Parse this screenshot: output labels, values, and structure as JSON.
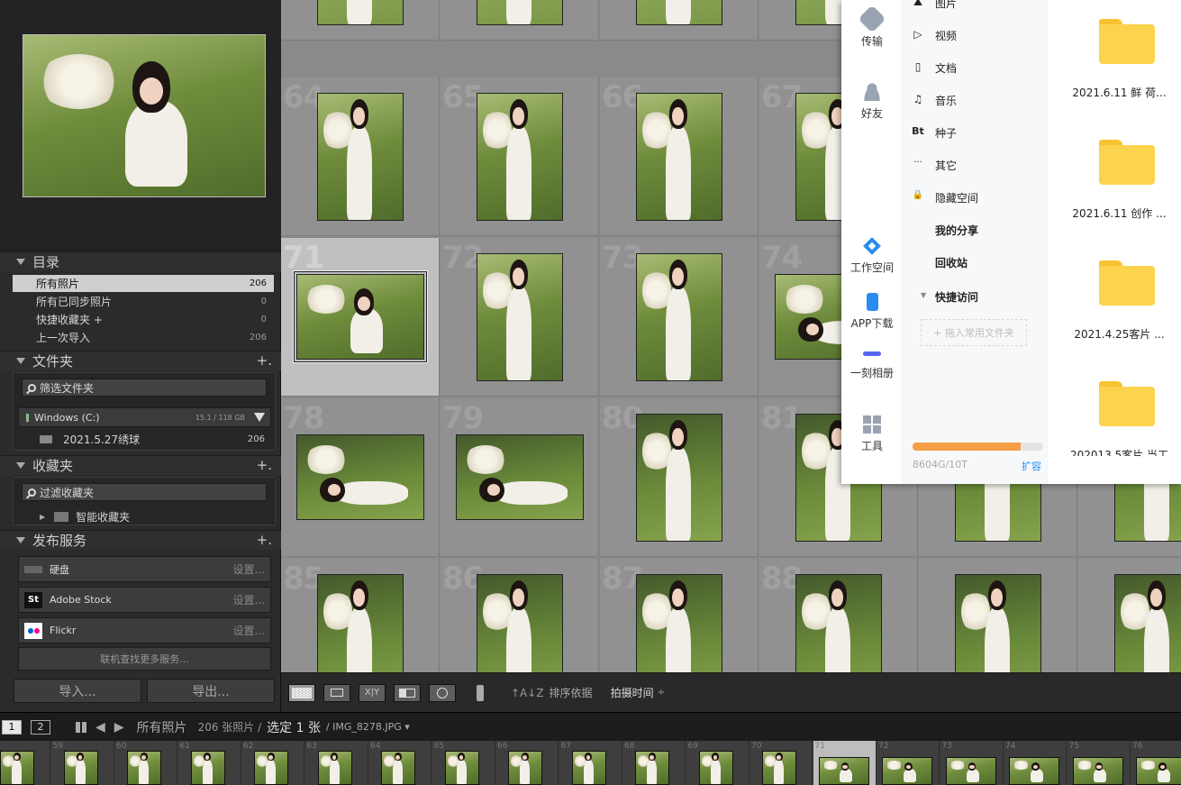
{
  "left_panel": {
    "catalog": {
      "title": "目录",
      "items": [
        {
          "label": "所有照片",
          "count": "206"
        },
        {
          "label": "所有已同步照片",
          "count": "0"
        },
        {
          "label": "快捷收藏夹 +",
          "count": "0"
        },
        {
          "label": "上一次导入",
          "count": "206"
        }
      ]
    },
    "folders": {
      "title": "文件夹",
      "plus": "+.",
      "filter_placeholder": "筛选文件夹",
      "volume_name": "Windows (C:)",
      "volume_capacity": "15.1 / 118 GB",
      "folder_name": "2021.5.27绣球",
      "folder_count": "206"
    },
    "collections": {
      "title": "收藏夹",
      "plus": "+.",
      "filter_placeholder": "过滤收藏夹",
      "smart_collection": "智能收藏夹"
    },
    "publish": {
      "title": "发布服务",
      "plus": "+.",
      "services": [
        {
          "label": "硬盘",
          "setting": "设置..."
        },
        {
          "label": "Adobe Stock",
          "setting": "设置..."
        },
        {
          "label": "Flickr",
          "setting": "设置..."
        }
      ],
      "more": "联机查找更多服务..."
    },
    "import_label": "导入...",
    "export_label": "导出..."
  },
  "grid": {
    "rows": [
      [
        "",
        "",
        "",
        ""
      ],
      [
        "64",
        "65",
        "66",
        "67"
      ],
      [
        "71",
        "72",
        "73",
        "74"
      ],
      [
        "78",
        "79",
        "80",
        "81"
      ],
      [
        "85",
        "86",
        "87",
        "88"
      ]
    ],
    "selected": "71"
  },
  "toolbar": {
    "sort_label": "排序依据",
    "sort_value": "拍摄时间",
    "sort_arrow": "÷"
  },
  "filmstrip_bar": {
    "mode1": "1",
    "mode2": "2",
    "source": "所有照片",
    "count_text": "206 张照片 /",
    "selected_text": "选定 1 张",
    "filename": "/ IMG_8278.JPG ▾"
  },
  "filmstrip": {
    "numbers": [
      "",
      "59",
      "60",
      "61",
      "62",
      "63",
      "64",
      "65",
      "66",
      "67",
      "68",
      "69",
      "70",
      "71",
      "72",
      "73",
      "74",
      "75",
      "76"
    ],
    "current": "71"
  },
  "popup": {
    "rail": [
      {
        "label": "传输",
        "icon": "transfer-icon"
      },
      {
        "label": "好友",
        "icon": "friends-icon"
      },
      {
        "label": "工作空间",
        "icon": "workspace-icon"
      },
      {
        "label": "APP下载",
        "icon": "phone-icon"
      },
      {
        "label": "一刻相册",
        "icon": "album-icon"
      },
      {
        "label": "工具",
        "icon": "tools-icon"
      }
    ],
    "menu": [
      {
        "label": "图片",
        "glyph": "⛰"
      },
      {
        "label": "视频",
        "glyph": "▷"
      },
      {
        "label": "文档",
        "glyph": "▯"
      },
      {
        "label": "音乐",
        "glyph": "♫"
      },
      {
        "label": "种子",
        "glyph": "Bt"
      },
      {
        "label": "其它",
        "glyph": "···"
      },
      {
        "label": "隐藏空间",
        "glyph": "🔒"
      }
    ],
    "my_share": "我的分享",
    "recycle": "回收站",
    "quick_access": "快捷访问",
    "drag_hint": "+ 拖入常用文件夹",
    "storage_text": "8604G/10T",
    "storage_fraction": 0.83,
    "expand_label": "扩容",
    "folders": [
      "2021.6.11 鲜 荷...",
      "2021.6.11 创作 ...",
      "2021.4.25客片 ...",
      "202013.5客片 当工"
    ]
  }
}
